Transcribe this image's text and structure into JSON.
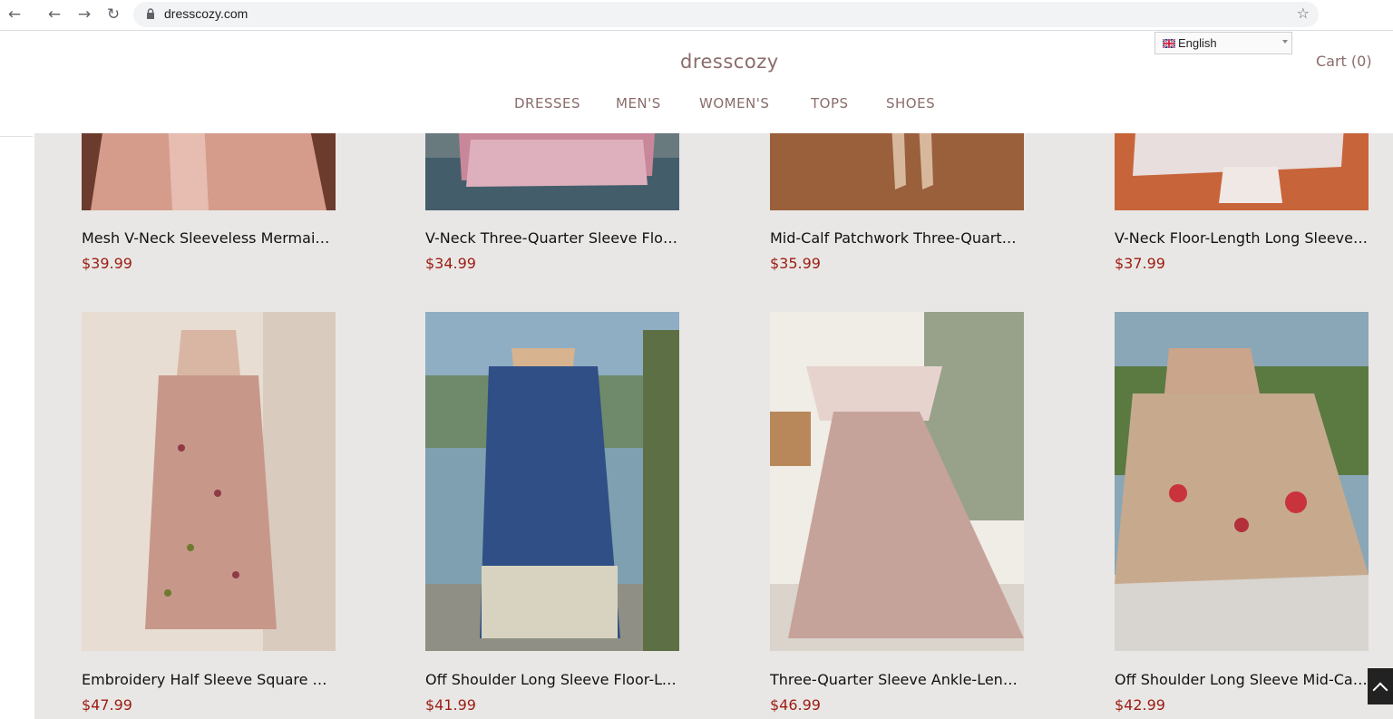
{
  "browser": {
    "url": "dresscozy.com",
    "back_icon": "arrow-left-icon",
    "forward_icon": "arrow-right-icon",
    "reload_icon": "reload-icon",
    "lock_icon": "lock-icon",
    "bookmark_icon": "star-icon"
  },
  "header": {
    "logo": "dresscozy",
    "menu": [
      "DRESSES",
      "MEN'S",
      "WOMEN'S",
      "TOPS",
      "SHOES"
    ],
    "language": "English",
    "cart": "Cart (0)"
  },
  "products_row1": [
    {
      "title": "Mesh V-Neck Sleeveless Mermaid Dress",
      "price": "$39.99",
      "palette": [
        "#6b3b2e",
        "#d59c8c"
      ]
    },
    {
      "title": "V-Neck Three-Quarter Sleeve Floral Dress",
      "price": "$34.99",
      "palette": [
        "#c9879a",
        "#445d6a"
      ]
    },
    {
      "title": "Mid-Calf Patchwork Three-Quarter Sleeve Dress",
      "price": "$35.99",
      "palette": [
        "#7a4a2c",
        "#a86b45"
      ]
    },
    {
      "title": "V-Neck Floor-Length Long Sleeve Dress",
      "price": "$37.99",
      "palette": [
        "#c8643a",
        "#e8dedd"
      ]
    }
  ],
  "products_row2": [
    {
      "title": "Embroidery Half Sleeve Square Neck Dress",
      "price": "$47.99",
      "palette": [
        "#e8ddd2",
        "#c7988a"
      ]
    },
    {
      "title": "Off Shoulder Long Sleeve Floor-Length Dress",
      "price": "$41.99",
      "palette": [
        "#2f4f86",
        "#7ea0b0"
      ]
    },
    {
      "title": "Three-Quarter Sleeve Ankle-Length Dress",
      "price": "$46.99",
      "palette": [
        "#e7d3cd",
        "#c6a39a"
      ]
    },
    {
      "title": "Off Shoulder Long Sleeve Mid-Calf Dress",
      "price": "$42.99",
      "palette": [
        "#c7aa8e",
        "#5a7a42"
      ]
    }
  ],
  "colors": {
    "price": "#9b1c12",
    "brand": "#8a6d6a",
    "page_bg": "#e9e7e5"
  }
}
